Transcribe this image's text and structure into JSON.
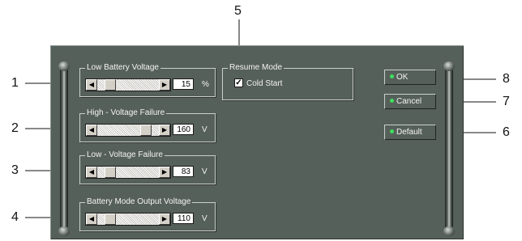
{
  "groups": {
    "low_battery": {
      "title": "Low Battery Voltage",
      "value": "15",
      "unit": "%",
      "level": 0.15
    },
    "high_voltage": {
      "title": "High - Voltage Failure",
      "value": "160",
      "unit": "V",
      "level": 0.85
    },
    "low_voltage": {
      "title": "Low - Voltage Failure",
      "value": "83",
      "unit": "V",
      "level": 0.15
    },
    "battery_output": {
      "title": "Battery Mode Output Voltage",
      "value": "110",
      "unit": "V",
      "level": 0.15
    }
  },
  "resume": {
    "title": "Resume Mode",
    "checkbox_label": "Cold Start",
    "checked": true
  },
  "buttons": {
    "ok": "OK",
    "cancel": "Cancel",
    "default": "Default"
  },
  "callouts": {
    "c1": "1",
    "c2": "2",
    "c3": "3",
    "c4": "4",
    "c5": "5",
    "c6": "6",
    "c7": "7",
    "c8": "8"
  },
  "colors": {
    "panel": "#56605a",
    "led": "#3fe05c",
    "text": "#f3f3f3"
  }
}
